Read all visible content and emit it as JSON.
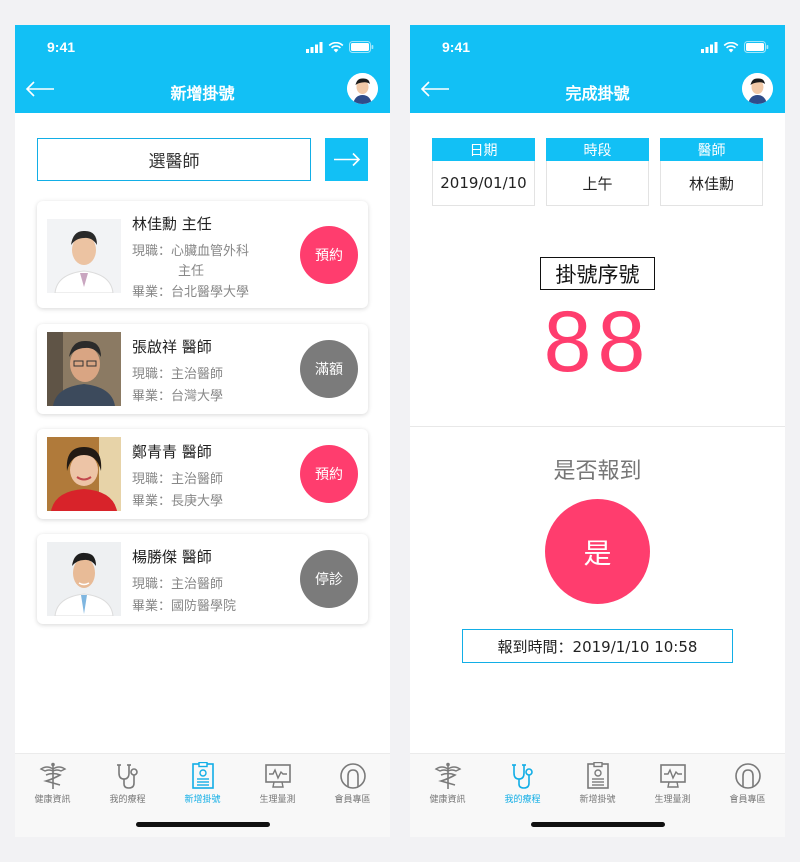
{
  "colors": {
    "accent": "#12c0f5",
    "pink": "#ff3d6e",
    "gray": "#7b7b7b"
  },
  "status_bar": {
    "time": "9:41"
  },
  "screen_new": {
    "title": "新增掛號",
    "select_label": "選醫師",
    "doctors": [
      {
        "name": "林佳勳 主任",
        "position": "現職：心臟血管外科",
        "position_cont": "主任",
        "school": "畢業：台北醫學大學",
        "button": "預約",
        "button_color": "#ff3d6e"
      },
      {
        "name": "張啟祥 醫師",
        "position": "現職：主治醫師",
        "school": "畢業：台灣大學",
        "button": "滿額",
        "button_color": "#7b7b7b"
      },
      {
        "name": "鄭青青 醫師",
        "position": "現職：主治醫師",
        "school": "畢業：長庚大學",
        "button": "預約",
        "button_color": "#ff3d6e"
      },
      {
        "name": "楊勝傑 醫師",
        "position": "現職：主治醫師",
        "school": "畢業：國防醫學院",
        "button": "停診",
        "button_color": "#7b7b7b"
      }
    ]
  },
  "screen_done": {
    "title": "完成掛號",
    "info": [
      {
        "header": "日期",
        "value": "2019/01/10"
      },
      {
        "header": "時段",
        "value": "上午"
      },
      {
        "header": "醫師",
        "value": "林佳勳"
      }
    ],
    "serial_label": "掛號序號",
    "serial_number": "88",
    "checkin_question": "是否報到",
    "checkin_button": "是",
    "checkin_time": "報到時間：2019/1/10 10:58"
  },
  "tabs": [
    {
      "label": "健康資訊",
      "icon": "caduceus-icon"
    },
    {
      "label": "我的療程",
      "icon": "stethoscope-icon"
    },
    {
      "label": "新增掛號",
      "icon": "registration-icon"
    },
    {
      "label": "生理量測",
      "icon": "monitor-icon"
    },
    {
      "label": "會員專區",
      "icon": "member-icon"
    }
  ],
  "active_tab": {
    "screen_new": "新增掛號",
    "screen_done": "我的療程"
  }
}
